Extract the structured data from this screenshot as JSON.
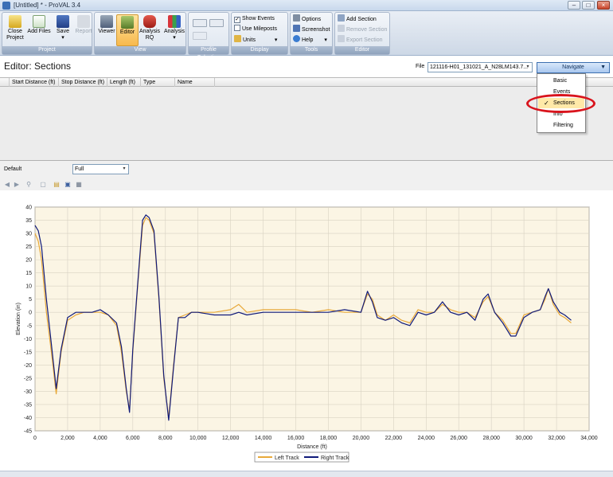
{
  "window": {
    "title": "[Untitled] * - ProVAL 3.4"
  },
  "ribbon": {
    "project": {
      "label": "Project",
      "close": "Close\nProject",
      "add_files": "Add Files",
      "save": "Save",
      "report": "Report"
    },
    "view": {
      "label": "View",
      "viewer": "Viewer",
      "editor": "Editor",
      "analysis_rq": "Analysis\nRQ",
      "analysis": "Analysis"
    },
    "profile_selection": {
      "label": "Profile Selection"
    },
    "display": {
      "label": "Display",
      "show_events": "Show Events",
      "use_mileposts": "Use Mileposts",
      "units": "Units"
    },
    "tools": {
      "label": "Tools",
      "options": "Options",
      "screenshot": "Screenshot",
      "help": "Help"
    },
    "editor": {
      "label": "Editor",
      "add_section": "Add Section",
      "remove_section": "Remove Section",
      "export_section": "Export Section"
    }
  },
  "editor": {
    "title": "Editor: Sections",
    "file_label": "File",
    "file_value": "121116-H01_131021_A_N28LM143.7...",
    "navigate_label": "Navigate"
  },
  "navigate_menu": [
    "Basic",
    "Events",
    "Sections",
    "Info",
    "Filtering"
  ],
  "navigate_selected": "Sections",
  "columns": [
    "Start Distance (ft)",
    "Stop Distance (ft)",
    "Length (ft)",
    "Type",
    "Name"
  ],
  "default_row": {
    "label": "Default",
    "value": "Full"
  },
  "colors": {
    "left_track": "#e8a93a",
    "right_track": "#101a7a",
    "plot_bg": "#fbf5e4",
    "highlight": "#d9141d"
  },
  "chart_data": {
    "type": "line",
    "xlabel": "Distance (ft)",
    "ylabel": "Elevation (in)",
    "xlim": [
      0,
      34000
    ],
    "ylim": [
      -45,
      40
    ],
    "x_ticks": [
      0,
      2000,
      4000,
      6000,
      8000,
      10000,
      12000,
      14000,
      16000,
      18000,
      20000,
      22000,
      24000,
      26000,
      28000,
      30000,
      32000,
      34000
    ],
    "x_tick_labels": [
      "0",
      "2,000",
      "4,000",
      "6,000",
      "8,000",
      "10,000",
      "12,000",
      "14,000",
      "16,000",
      "18,000",
      "20,000",
      "22,000",
      "24,000",
      "26,000",
      "28,000",
      "30,000",
      "32,000",
      "34,000"
    ],
    "y_ticks": [
      40,
      35,
      30,
      25,
      20,
      15,
      10,
      5,
      0,
      -5,
      -10,
      -15,
      -20,
      -25,
      -30,
      -35,
      -40,
      -45
    ],
    "grid": true,
    "legend_position": "bottom-center",
    "series": [
      {
        "name": "Left Track",
        "x": [
          0,
          200,
          400,
          700,
          1000,
          1300,
          1600,
          2000,
          2500,
          3000,
          3500,
          4000,
          4500,
          5000,
          5300,
          5600,
          5800,
          6000,
          6300,
          6600,
          6800,
          7000,
          7300,
          7600,
          7900,
          8200,
          8500,
          8800,
          9200,
          9600,
          10000,
          11000,
          12000,
          12500,
          13000,
          14000,
          15000,
          16000,
          17000,
          18000,
          19000,
          20000,
          20400,
          20700,
          21000,
          21500,
          22000,
          22500,
          23000,
          23500,
          24000,
          24500,
          25000,
          25500,
          26000,
          26500,
          27000,
          27500,
          27800,
          28200,
          28700,
          29200,
          29500,
          30000,
          30500,
          31000,
          31300,
          31500,
          31800,
          32200,
          32500,
          32900
        ],
        "values": [
          30,
          27,
          20,
          0,
          -15,
          -31,
          -15,
          -3,
          -1,
          0,
          0,
          0,
          -1,
          -5,
          -15,
          -30,
          -37,
          -15,
          10,
          33,
          36,
          35,
          30,
          5,
          -25,
          -40,
          -20,
          -2,
          -1,
          0,
          0,
          0,
          1,
          3,
          0,
          1,
          1,
          1,
          0,
          1,
          0,
          0,
          7,
          5,
          -1,
          -3,
          -1,
          -3,
          -4,
          1,
          0,
          0,
          3,
          1,
          0,
          0,
          -2,
          4,
          6,
          0,
          -3,
          -8,
          -8,
          -1,
          0,
          1,
          5,
          9,
          3,
          -1,
          -2,
          -4
        ]
      },
      {
        "name": "Right Track",
        "x": [
          0,
          200,
          400,
          700,
          1000,
          1300,
          1600,
          2000,
          2500,
          3000,
          3500,
          4000,
          4500,
          5000,
          5300,
          5600,
          5800,
          6000,
          6300,
          6600,
          6800,
          7000,
          7300,
          7600,
          7900,
          8200,
          8500,
          8800,
          9200,
          9600,
          10000,
          11000,
          12000,
          12500,
          13000,
          14000,
          15000,
          16000,
          17000,
          18000,
          19000,
          20000,
          20400,
          20700,
          21000,
          21500,
          22000,
          22500,
          23000,
          23500,
          24000,
          24500,
          25000,
          25500,
          26000,
          26500,
          27000,
          27500,
          27800,
          28200,
          28700,
          29200,
          29500,
          30000,
          30500,
          31000,
          31300,
          31500,
          31800,
          32200,
          32500,
          32900
        ],
        "values": [
          33,
          31,
          25,
          5,
          -12,
          -29,
          -14,
          -2,
          0,
          0,
          0,
          1,
          -1,
          -4,
          -13,
          -29,
          -38,
          -14,
          11,
          35,
          37,
          36,
          31,
          6,
          -24,
          -41,
          -21,
          -2,
          -2,
          0,
          0,
          -1,
          -1,
          0,
          -1,
          0,
          0,
          0,
          0,
          0,
          1,
          0,
          8,
          4,
          -2,
          -3,
          -2,
          -4,
          -5,
          0,
          -1,
          0,
          4,
          0,
          -1,
          0,
          -3,
          5,
          7,
          0,
          -4,
          -9,
          -9,
          -2,
          0,
          1,
          6,
          9,
          4,
          0,
          -1,
          -3
        ]
      }
    ]
  }
}
